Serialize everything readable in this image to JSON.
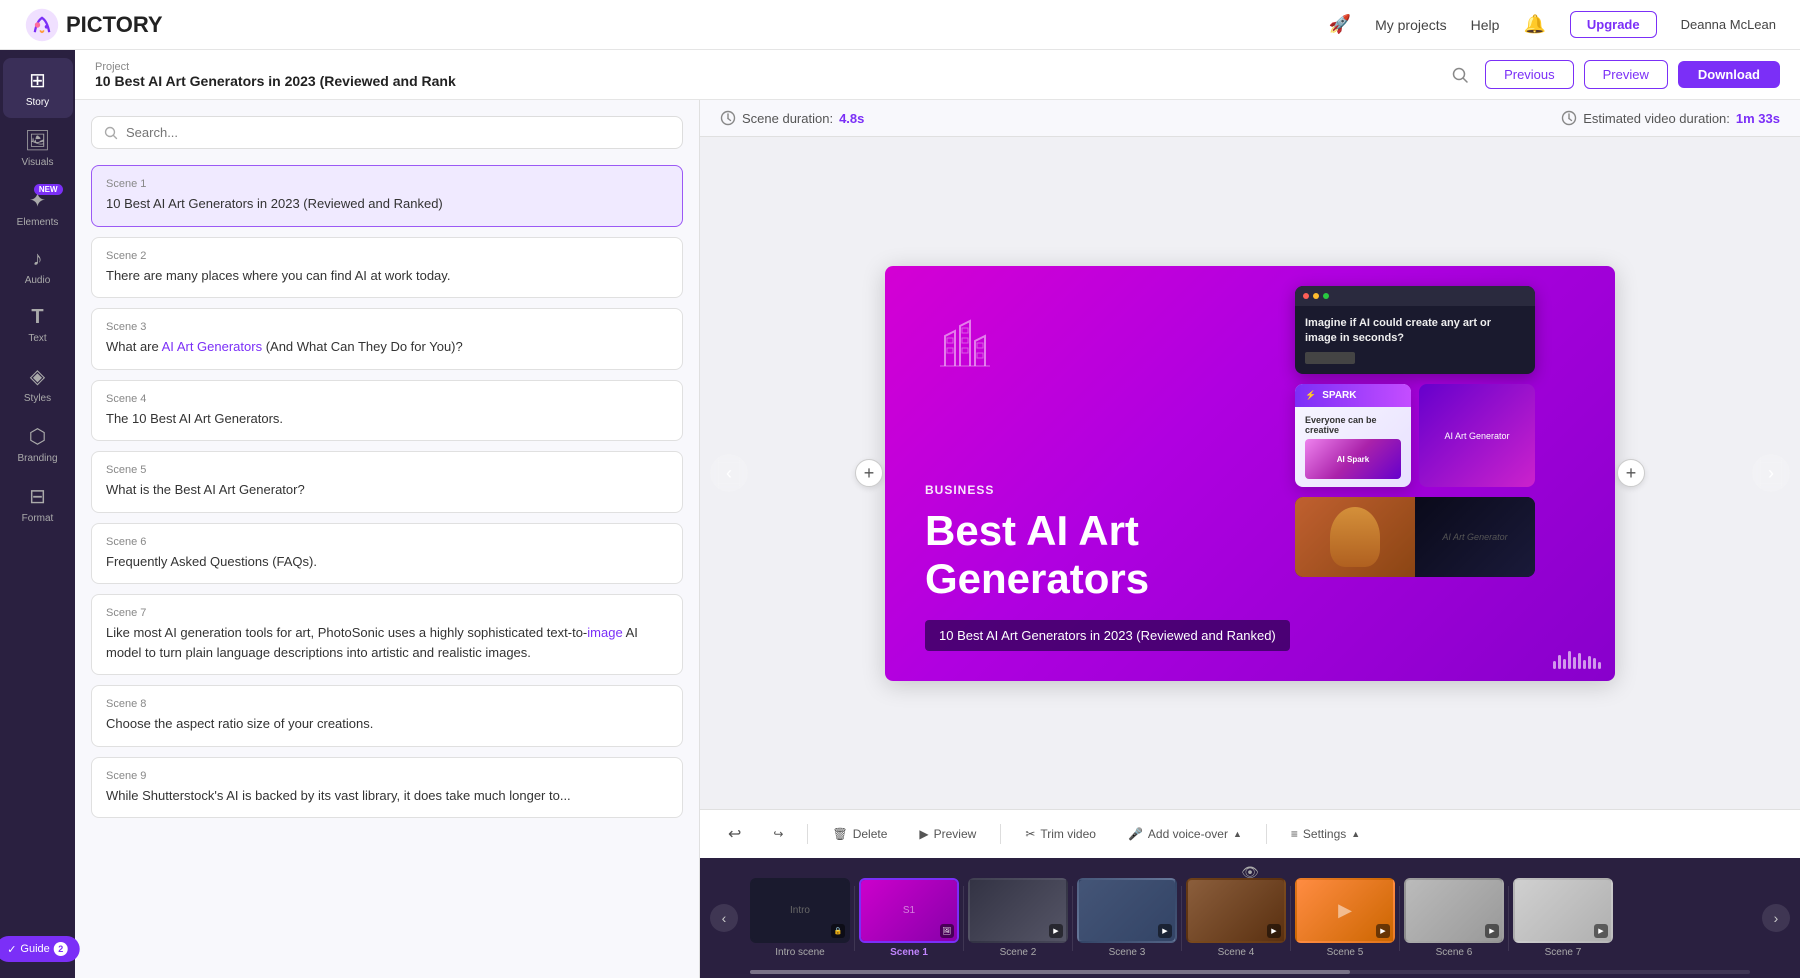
{
  "app": {
    "name": "PICTORY",
    "logo_text": "PICTORY"
  },
  "top_nav": {
    "rocket_icon": "🚀",
    "my_projects": "My projects",
    "help": "Help",
    "bell_icon": "🔔",
    "upgrade_label": "Upgrade",
    "user_name": "Deanna McLean"
  },
  "project": {
    "label": "Project",
    "title": "10 Best AI Art Generators in 2023 (Reviewed and Rank"
  },
  "header_actions": {
    "previous_label": "Previous",
    "preview_label": "Preview",
    "download_label": "Download"
  },
  "sidebar": {
    "items": [
      {
        "id": "story",
        "label": "Story",
        "icon": "⊞",
        "active": true
      },
      {
        "id": "visuals",
        "label": "Visuals",
        "icon": "🖼"
      },
      {
        "id": "elements",
        "label": "Elements",
        "icon": "✦",
        "badge": "NEW"
      },
      {
        "id": "audio",
        "label": "Audio",
        "icon": "♪"
      },
      {
        "id": "text",
        "label": "Text",
        "icon": "T"
      },
      {
        "id": "styles",
        "label": "Styles",
        "icon": "◈"
      },
      {
        "id": "branding",
        "label": "Branding",
        "icon": "⬡"
      },
      {
        "id": "format",
        "label": "Format",
        "icon": "⊟"
      }
    ]
  },
  "story_panel": {
    "search_placeholder": "Search...",
    "scenes": [
      {
        "id": "scene1",
        "number": "Scene 1",
        "text": "10 Best AI Art Generators in 2023 (Reviewed and Ranked)",
        "active": true,
        "highlights": []
      },
      {
        "id": "scene2",
        "number": "Scene 2",
        "text": "There are many places where you can find AI at work today.",
        "active": false,
        "highlights": []
      },
      {
        "id": "scene3",
        "number": "Scene 3",
        "text": "What are AI Art Generators (And What Can They Do for You)?",
        "active": false,
        "highlights": [
          "AI Art Generators"
        ]
      },
      {
        "id": "scene4",
        "number": "Scene 4",
        "text": "The 10 Best AI Art Generators.",
        "active": false,
        "highlights": []
      },
      {
        "id": "scene5",
        "number": "Scene 5",
        "text": "What is the Best AI Art Generator?",
        "active": false,
        "highlights": []
      },
      {
        "id": "scene6",
        "number": "Scene 6",
        "text": "Frequently Asked Questions (FAQs).",
        "active": false,
        "highlights": []
      },
      {
        "id": "scene7",
        "number": "Scene 7",
        "text": "Like most AI generation tools for art, PhotoSonic uses a highly sophisticated text-to-image AI model to turn plain language descriptions into artistic and realistic images.",
        "active": false,
        "highlights": [
          "image"
        ]
      },
      {
        "id": "scene8",
        "number": "Scene 8",
        "text": "Choose the aspect ratio size of your creations.",
        "active": false,
        "highlights": []
      },
      {
        "id": "scene9",
        "number": "Scene 9",
        "text": "While Shutterstock's AI is backed by its vast library, it does take much longer to...",
        "active": false,
        "highlights": []
      }
    ]
  },
  "preview": {
    "scene_duration_label": "Scene duration:",
    "scene_duration_value": "4.8s",
    "estimated_label": "Estimated video duration:",
    "estimated_value": "1m 33s",
    "video": {
      "category": "BUSINESS",
      "title_line1": "Best AI Art",
      "title_line2": "Generators",
      "caption": "10 Best AI Art Generators in 2023 (Reviewed and Ranked)"
    }
  },
  "toolbar": {
    "undo_label": "↩",
    "redo_label": "↪",
    "delete_label": "Delete",
    "preview_label": "Preview",
    "trim_label": "Trim video",
    "voice_label": "Add voice-over",
    "settings_label": "Settings"
  },
  "timeline": {
    "scenes": [
      {
        "id": "intro",
        "label": "Intro scene",
        "active": false,
        "style": "dark"
      },
      {
        "id": "scene1",
        "label": "Scene 1",
        "active": true,
        "style": "pink"
      },
      {
        "id": "scene2",
        "label": "Scene 2",
        "active": false,
        "style": "warrior"
      },
      {
        "id": "scene3",
        "label": "Scene 3",
        "active": false,
        "style": "anime"
      },
      {
        "id": "scene4",
        "label": "Scene 4",
        "active": false,
        "style": "nature"
      },
      {
        "id": "scene5",
        "label": "Scene 5",
        "active": false,
        "style": "orange"
      },
      {
        "id": "scene6",
        "label": "Scene 6",
        "active": false,
        "style": "grey"
      },
      {
        "id": "scene7",
        "label": "Scene 7",
        "active": false,
        "style": "light"
      }
    ]
  },
  "colors": {
    "accent": "#7b2ff7",
    "sidebar_bg": "#2a2040",
    "timeline_bg": "#2a2040"
  }
}
